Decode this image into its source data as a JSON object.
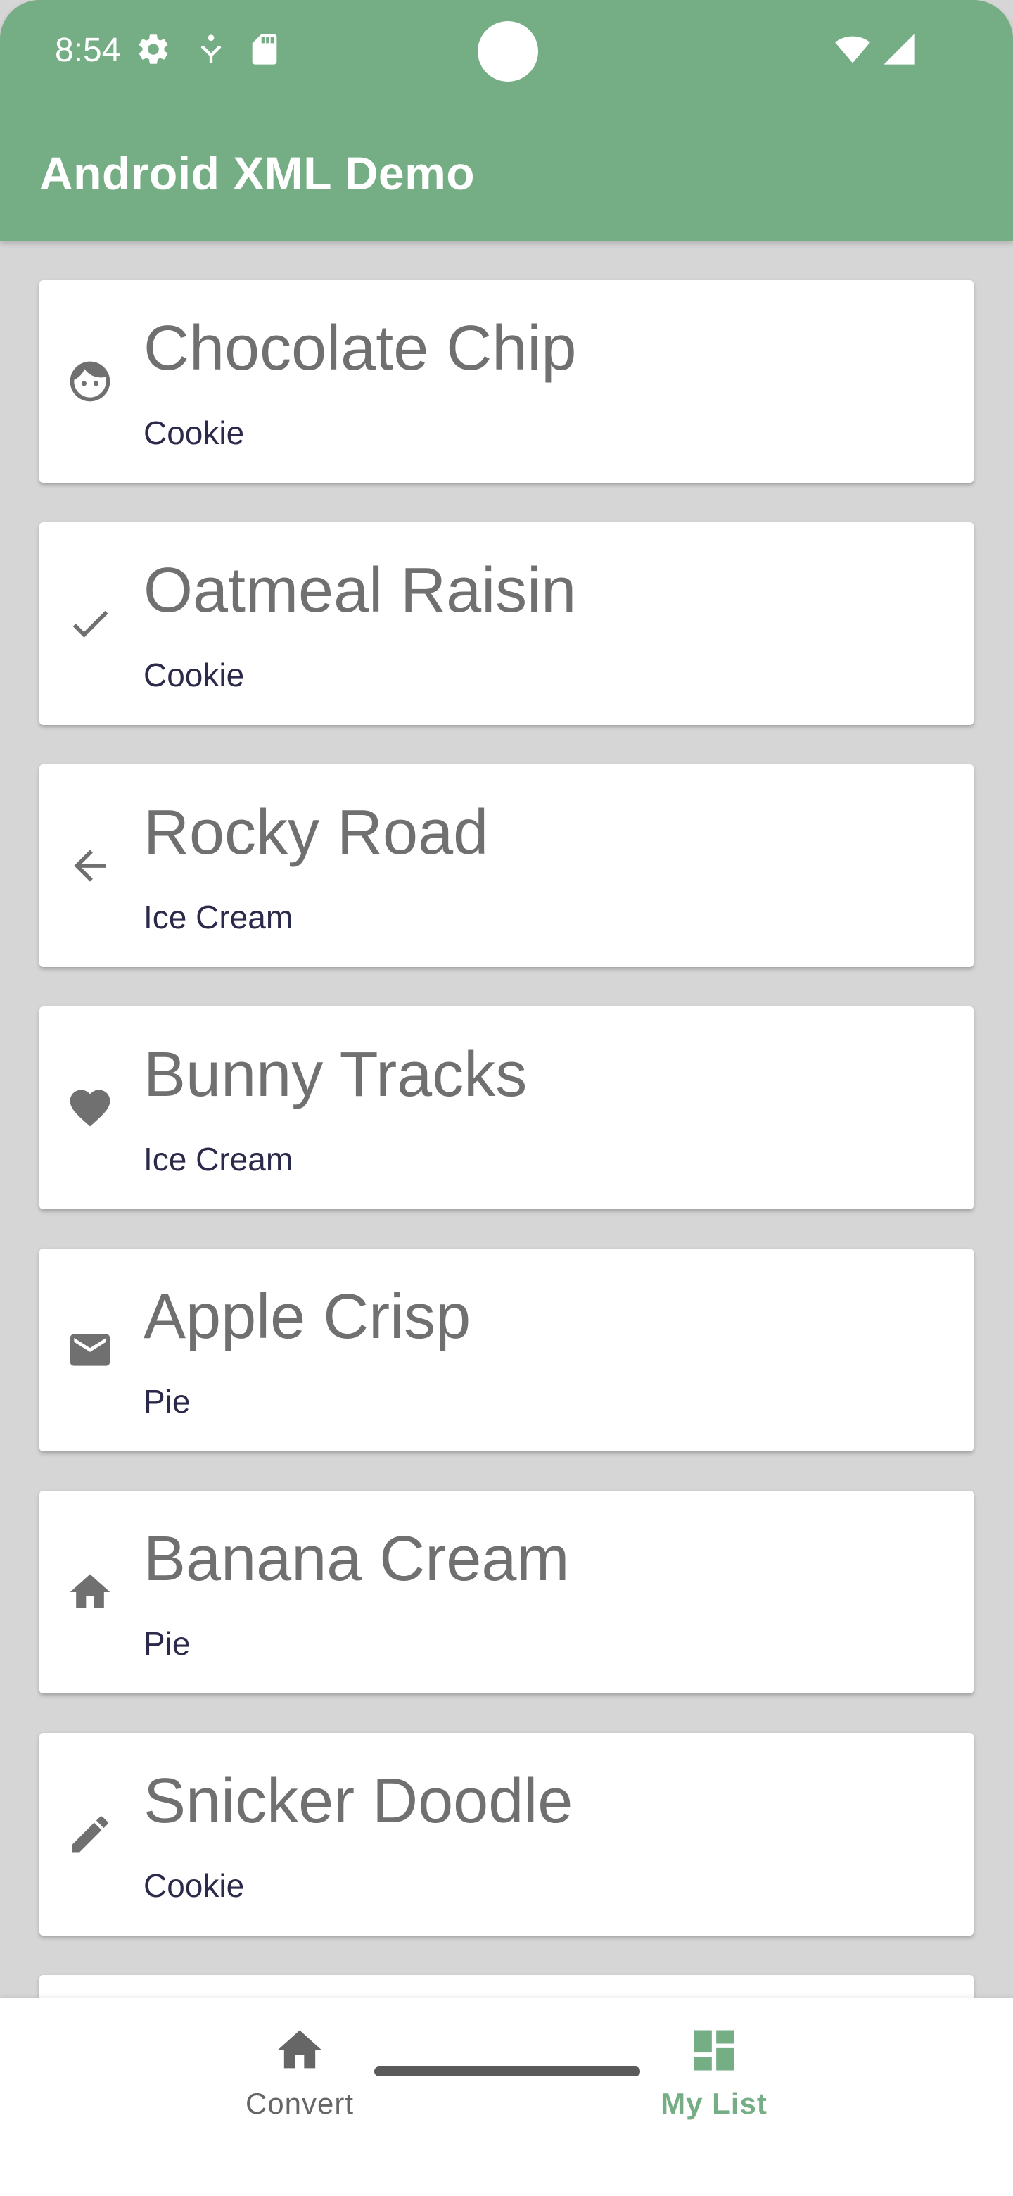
{
  "status_bar": {
    "time": "8:54",
    "left_icons": [
      "settings-icon",
      "accessibility-icon",
      "sd-card-icon"
    ],
    "right_icons": [
      "wifi-icon",
      "cell-signal-icon"
    ]
  },
  "app_bar": {
    "title": "Android XML Demo"
  },
  "colors": {
    "primary": "#75ad84",
    "background": "#d6d6d6",
    "card": "#ffffff",
    "title_text": "#707070",
    "subtitle_text": "#2c2a4a",
    "nav_active": "#75ad84",
    "nav_inactive": "#666666"
  },
  "list": {
    "items": [
      {
        "title": "Chocolate Chip",
        "subtitle": "Cookie",
        "icon": "face-icon"
      },
      {
        "title": "Oatmeal Raisin",
        "subtitle": "Cookie",
        "icon": "check-icon"
      },
      {
        "title": "Rocky Road",
        "subtitle": "Ice Cream",
        "icon": "arrow-back-icon"
      },
      {
        "title": "Bunny Tracks",
        "subtitle": "Ice Cream",
        "icon": "heart-icon"
      },
      {
        "title": "Apple Crisp",
        "subtitle": "Pie",
        "icon": "mail-icon"
      },
      {
        "title": "Banana Cream",
        "subtitle": "Pie",
        "icon": "home-icon"
      },
      {
        "title": "Snicker Doodle",
        "subtitle": "Cookie",
        "icon": "edit-icon"
      },
      {
        "title": "",
        "subtitle": "",
        "icon": ""
      }
    ]
  },
  "bottom_nav": {
    "items": [
      {
        "label": "Convert",
        "icon": "home-icon",
        "active": false
      },
      {
        "label": "My List",
        "icon": "dashboard-icon",
        "active": true
      }
    ]
  }
}
